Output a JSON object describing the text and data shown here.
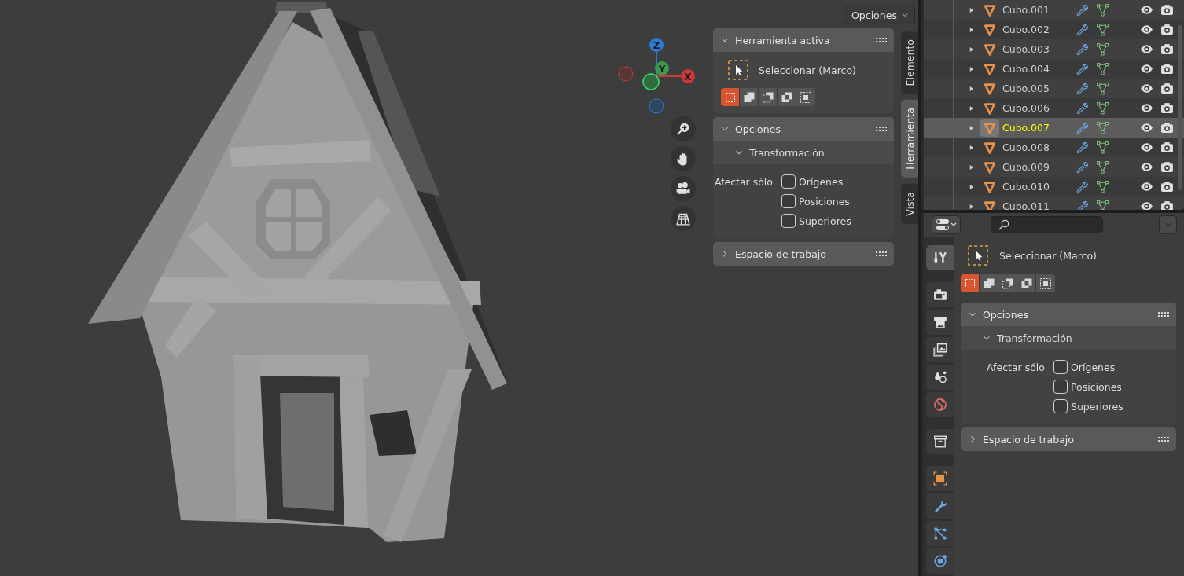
{
  "viewport": {
    "options_menu": "Opciones",
    "gizmo_axes": [
      {
        "label": "Z",
        "color": "#2f7ad4"
      },
      {
        "label": "Y",
        "color": "#3a9b4f"
      },
      {
        "label": "X",
        "color": "#c93a3a"
      }
    ],
    "tool_settings": {
      "header": {
        "title": "Herramienta activa",
        "expanded": true
      },
      "tool_name": "Seleccionar (Marco)",
      "modes": [
        {
          "kind": "set",
          "selected": true
        },
        {
          "kind": "extend",
          "selected": false
        },
        {
          "kind": "subtract",
          "selected": false
        },
        {
          "kind": "difference",
          "selected": false
        },
        {
          "kind": "intersect",
          "selected": false
        }
      ],
      "panels": [
        {
          "title": "Opciones",
          "expanded": true,
          "subpanels": [
            {
              "title": "Transformación",
              "expanded": true,
              "label": "Afectar sólo",
              "options": [
                {
                  "label": "Orígenes",
                  "checked": false
                },
                {
                  "label": "Posiciones",
                  "checked": false
                },
                {
                  "label": "Superiores",
                  "checked": false
                }
              ]
            }
          ]
        },
        {
          "title": "Espacio de trabajo",
          "expanded": false
        }
      ]
    },
    "sidebar_tabs": [
      {
        "label": "Elemento",
        "selected": false
      },
      {
        "label": "Herramienta",
        "selected": true
      },
      {
        "label": "Vista",
        "selected": false
      }
    ]
  },
  "outliner": {
    "rows": [
      {
        "name": "Cubo.001",
        "selected": false
      },
      {
        "name": "Cubo.002",
        "selected": false
      },
      {
        "name": "Cubo.003",
        "selected": false
      },
      {
        "name": "Cubo.004",
        "selected": false
      },
      {
        "name": "Cubo.005",
        "selected": false
      },
      {
        "name": "Cubo.006",
        "selected": false
      },
      {
        "name": "Cubo.007",
        "selected": true
      },
      {
        "name": "Cubo.008",
        "selected": false
      },
      {
        "name": "Cubo.009",
        "selected": false
      },
      {
        "name": "Cubo.010",
        "selected": false
      },
      {
        "name": "Cubo.011",
        "selected": false
      }
    ]
  },
  "properties": {
    "tabs": [
      {
        "kind": "tool",
        "selected": true
      },
      {
        "kind": "render",
        "selected": false
      },
      {
        "kind": "output",
        "selected": false
      },
      {
        "kind": "view_layer",
        "selected": false
      },
      {
        "kind": "scene",
        "selected": false
      },
      {
        "kind": "world",
        "selected": false
      },
      {
        "kind": "collection",
        "selected": false
      },
      {
        "kind": "object",
        "selected": false
      },
      {
        "kind": "modifiers",
        "selected": false
      },
      {
        "kind": "particles",
        "selected": false
      },
      {
        "kind": "physics",
        "selected": false
      }
    ],
    "tool_settings": {
      "tool_name": "Seleccionar (Marco)",
      "modes": [
        {
          "kind": "set",
          "selected": true
        },
        {
          "kind": "extend",
          "selected": false
        },
        {
          "kind": "subtract",
          "selected": false
        },
        {
          "kind": "difference",
          "selected": false
        },
        {
          "kind": "intersect",
          "selected": false
        }
      ],
      "panels": [
        {
          "title": "Opciones",
          "expanded": true,
          "subpanels": [
            {
              "title": "Transformación",
              "expanded": true,
              "label": "Afectar sólo",
              "options": [
                {
                  "label": "Orígenes",
                  "checked": false
                },
                {
                  "label": "Posiciones",
                  "checked": false
                },
                {
                  "label": "Superiores",
                  "checked": false
                }
              ]
            }
          ]
        },
        {
          "title": "Espacio de trabajo",
          "expanded": false
        }
      ]
    }
  }
}
